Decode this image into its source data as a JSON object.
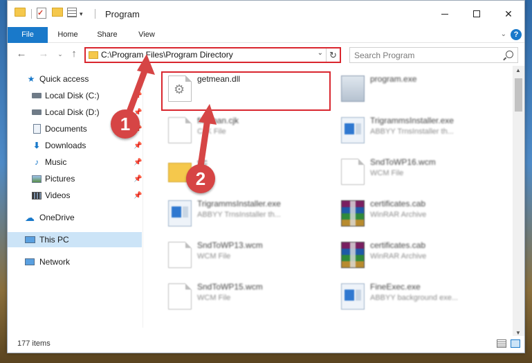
{
  "window": {
    "title": "Program"
  },
  "quick_access_toolbar": {
    "icons": [
      "folder-icon",
      "checkmark-properties-icon",
      "new-folder-icon",
      "properties-icon",
      "customize-dropdown-icon"
    ]
  },
  "ribbon": {
    "tabs": [
      {
        "label": "File"
      },
      {
        "label": "Home"
      },
      {
        "label": "Share"
      },
      {
        "label": "View"
      }
    ],
    "help_label": "?"
  },
  "address_bar": {
    "path": "C:\\Program Files\\Program Directory"
  },
  "search": {
    "placeholder": "Search Program"
  },
  "sidebar": {
    "items": [
      {
        "label": "Quick access",
        "icon": "star-icon",
        "pinned": false
      },
      {
        "label": "Local Disk (C:)",
        "icon": "drive-icon",
        "pinned": true
      },
      {
        "label": "Local Disk (D:)",
        "icon": "drive-icon",
        "pinned": true
      },
      {
        "label": "Documents",
        "icon": "documents-icon",
        "pinned": true
      },
      {
        "label": "Downloads",
        "icon": "download-icon",
        "pinned": true
      },
      {
        "label": "Music",
        "icon": "music-icon",
        "pinned": true
      },
      {
        "label": "Pictures",
        "icon": "pictures-icon",
        "pinned": true
      },
      {
        "label": "Videos",
        "icon": "videos-icon",
        "pinned": true
      },
      {
        "label": "OneDrive",
        "icon": "cloud-icon",
        "pinned": false
      },
      {
        "label": "This PC",
        "icon": "computer-icon",
        "pinned": false
      },
      {
        "label": "Network",
        "icon": "network-icon",
        "pinned": false
      }
    ],
    "selected": "This PC"
  },
  "files": {
    "col1": [
      {
        "name": "getmean.dll",
        "type": "",
        "icon": "dll-gear-icon"
      },
      {
        "name": "fio.chan.cjk",
        "type": "CJK File",
        "icon": "document-icon"
      },
      {
        "name": "sic",
        "type": "",
        "icon": "folder-icon"
      },
      {
        "name": "TrigrammsInstaller.exe",
        "type": "ABBYY TrnsInstaller th...",
        "icon": "exe-icon"
      },
      {
        "name": "SndToWP13.wcm",
        "type": "WCM File",
        "icon": "document-icon"
      },
      {
        "name": "SndToWP15.wcm",
        "type": "WCM File",
        "icon": "document-icon"
      }
    ],
    "col2": [
      {
        "name": "program.exe",
        "type": "",
        "icon": "program-exe-icon"
      },
      {
        "name": "TrigrammsInstaller.exe",
        "type": "ABBYY TrnsInstaller th...",
        "icon": "exe-icon"
      },
      {
        "name": "SndToWP16.wcm",
        "type": "WCM File",
        "icon": "document-icon"
      },
      {
        "name": "certificates.cab",
        "type": "WinRAR Archive",
        "icon": "winrar-icon"
      },
      {
        "name": "certificates.cab",
        "type": "WinRAR Archive",
        "icon": "winrar-icon"
      },
      {
        "name": "FineExec.exe",
        "type": "ABBYY background exe...",
        "icon": "exe-icon"
      }
    ]
  },
  "status_bar": {
    "item_count": "177 items"
  },
  "annotations": {
    "step1": "1",
    "step2": "2",
    "highlight_color": "#d9262e",
    "callout_color": "#d64545"
  },
  "colors": {
    "accent": "#1979ca",
    "selection": "#cce4f7"
  }
}
